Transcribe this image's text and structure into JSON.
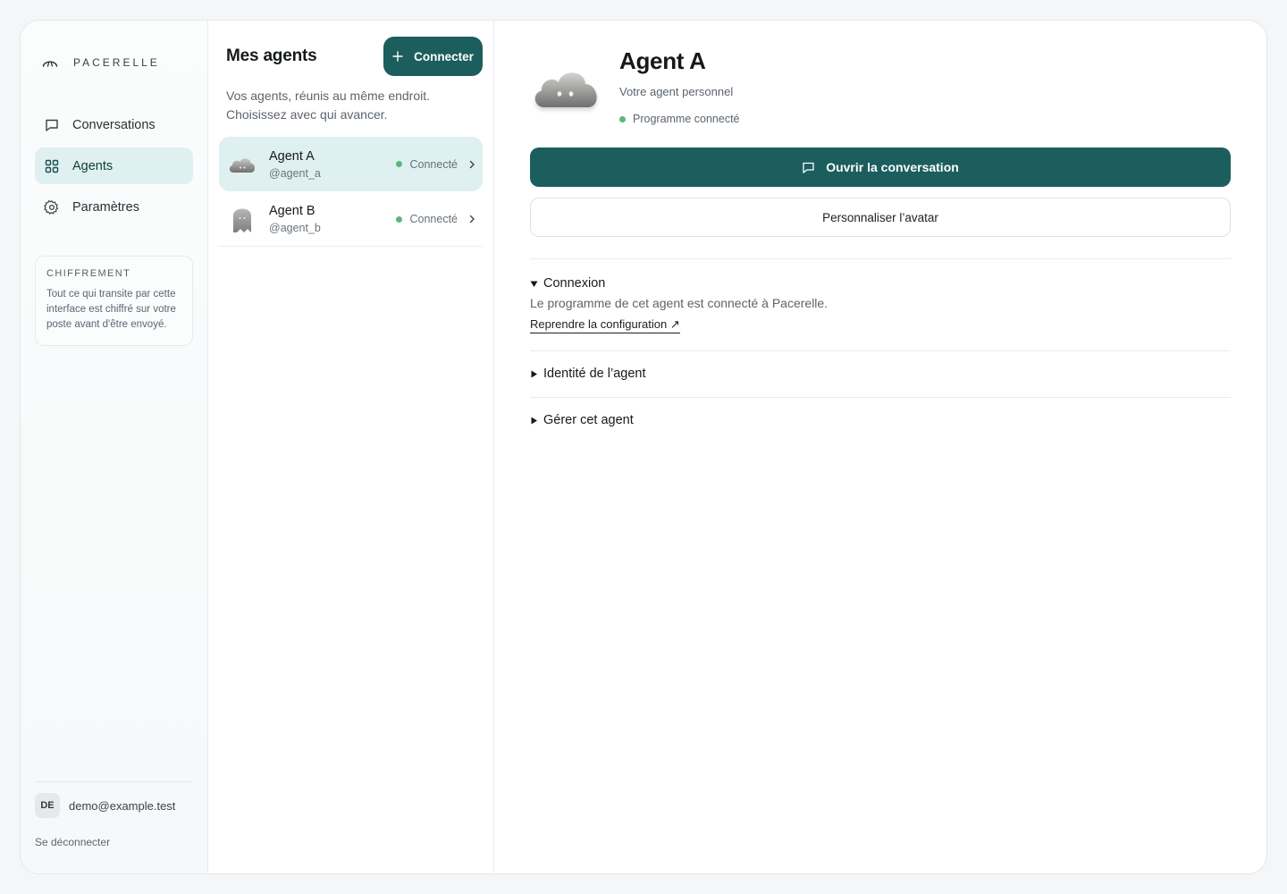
{
  "brand": {
    "name": "PACERELLE",
    "logo_icon": "arch-logo-icon"
  },
  "sidebar": {
    "items": [
      {
        "label": "Conversations",
        "icon": "chat-bubble-icon",
        "active": false
      },
      {
        "label": "Agents",
        "icon": "grid-icon",
        "active": true
      },
      {
        "label": "Paramètres",
        "icon": "gear-icon",
        "active": false
      }
    ],
    "info_card": {
      "title": "CHIFFREMENT",
      "text": "Tout ce qui transite par cette interface est chiffré sur votre poste avant d'être envoyé."
    },
    "account": {
      "initials": "DE",
      "email": "demo@example.test",
      "logout_label": "Se déconnecter"
    }
  },
  "agents_panel": {
    "title": "Mes agents",
    "connect_label": "Connecter",
    "subtitle_line1": "Vos agents, réunis au même endroit.",
    "subtitle_line2": "Choisissez avec qui avancer.",
    "agents": [
      {
        "name": "Agent A",
        "handle": "@agent_a",
        "status": "Connecté",
        "avatar": "cloud-avatar-icon",
        "selected": true
      },
      {
        "name": "Agent B",
        "handle": "@agent_b",
        "status": "Connecté",
        "avatar": "ghost-avatar-icon",
        "selected": false
      }
    ]
  },
  "detail": {
    "name": "Agent A",
    "subtitle": "Votre agent personnel",
    "status": "Programme connecté",
    "open_conversation_label": "Ouvrir la conversation",
    "customize_avatar_label": "Personnaliser l’avatar",
    "sections": {
      "connexion": {
        "title": "Connexion",
        "text": "Le programme de cet agent est connecté à Pacerelle.",
        "link": "Reprendre la configuration ↗"
      },
      "identity": {
        "title": "Identité de l’agent"
      },
      "manage": {
        "title": "Gérer cet agent"
      }
    }
  },
  "colors": {
    "accent": "#1b5e5d",
    "active_bg": "#dff0f1",
    "status_green": "#5cb57f"
  }
}
